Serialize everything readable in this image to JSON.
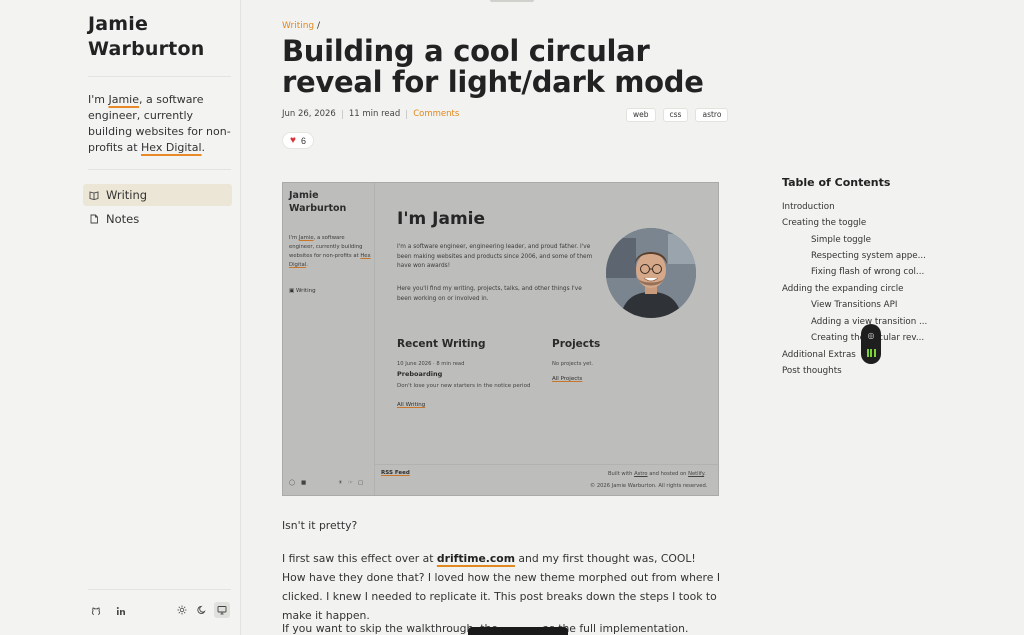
{
  "sidebar": {
    "site_name": "Jamie Warburton",
    "bio_pre": "I'm ",
    "bio_name": "Jamie",
    "bio_mid": ", a software engineer, currently building websites for non-profits at ",
    "bio_org": "Hex Digital",
    "bio_end": ".",
    "nav": [
      {
        "label": "Writing",
        "icon": "book-open-icon",
        "active": true
      },
      {
        "label": "Notes",
        "icon": "file-icon",
        "active": false
      }
    ],
    "footer_icons": [
      "github-icon",
      "linkedin-icon"
    ],
    "theme_buttons": [
      "sun-icon",
      "moon-icon",
      "monitor-icon"
    ]
  },
  "article": {
    "breadcrumb_link": "Writing",
    "breadcrumb_sep": "/",
    "title": "Building a cool circular reveal for light/dark mode",
    "date": "Jun 26, 2026",
    "read_time": "11 min read",
    "comments_link": "Comments",
    "tags": [
      "web",
      "css",
      "astro"
    ],
    "likes": "6",
    "paragraphs": {
      "p1": "Isn't it pretty?",
      "p2_pre": "I first saw this effect over at ",
      "p2_link": "driftime.com",
      "p2_post": " and my first thought was, COOL! How have they done that? I loved how the new theme morphed out from where I clicked. I knew I needed to replicate it. This post breaks down the steps I took to make it happen.",
      "p3": "If you want to skip the walkthrough, the ... ... ... as the full implementation."
    }
  },
  "preview": {
    "name": "Jamie Warburton",
    "bio_pre": "I'm ",
    "bio_name": "Jamie",
    "bio_mid": ", a software engineer, currently building websites for non-profits at ",
    "bio_org": "Hex Digital",
    "bio_end": ".",
    "nav_writing": "Writing",
    "heading": "I'm Jamie",
    "intro_1": "I'm a software engineer, engineering leader, and proud father. I've been making websites and products since 2006, and some of them have won awards!",
    "intro_2": "Here you'll find my writing, projects, talks, and other things I've been working on or involved in.",
    "recent_heading": "Recent Writing",
    "post_meta": "10 June 2026 · 8 min read",
    "post_title": "Preboarding",
    "post_desc": "Don't lose your new starters in the notice period",
    "all_writing": "All Writing",
    "projects_heading": "Projects",
    "no_projects": "No projects yet.",
    "all_projects": "All Projects",
    "rss": "RSS Feed",
    "built_with_pre": "Built with ",
    "built_with_astro": "Astro",
    "built_with_mid": " and hosted on ",
    "built_with_netlify": "Netlify",
    "built_with_end": ".",
    "copyright": "© 2026 Jamie Warburton. All rights reserved."
  },
  "toc": {
    "title": "Table of Contents",
    "items": [
      {
        "label": "Introduction",
        "level": 1
      },
      {
        "label": "Creating the toggle",
        "level": 1
      },
      {
        "label": "Simple toggle",
        "level": 2
      },
      {
        "label": "Respecting system appe...",
        "level": 2
      },
      {
        "label": "Fixing flash of wrong col...",
        "level": 2
      },
      {
        "label": "Adding the expanding circle",
        "level": 1
      },
      {
        "label": "View Transitions API",
        "level": 2
      },
      {
        "label": "Adding a view transition ...",
        "level": 2
      },
      {
        "label": "Creating the circular rev...",
        "level": 2
      },
      {
        "label": "Additional Extras",
        "level": 1
      },
      {
        "label": "Post thoughts",
        "level": 1
      }
    ]
  },
  "colors": {
    "accent": "#e0891f",
    "active_nav_bg": "#ece6d6",
    "pill_bg": "#1e1e1e",
    "pill_bars": "#7fd13a"
  }
}
